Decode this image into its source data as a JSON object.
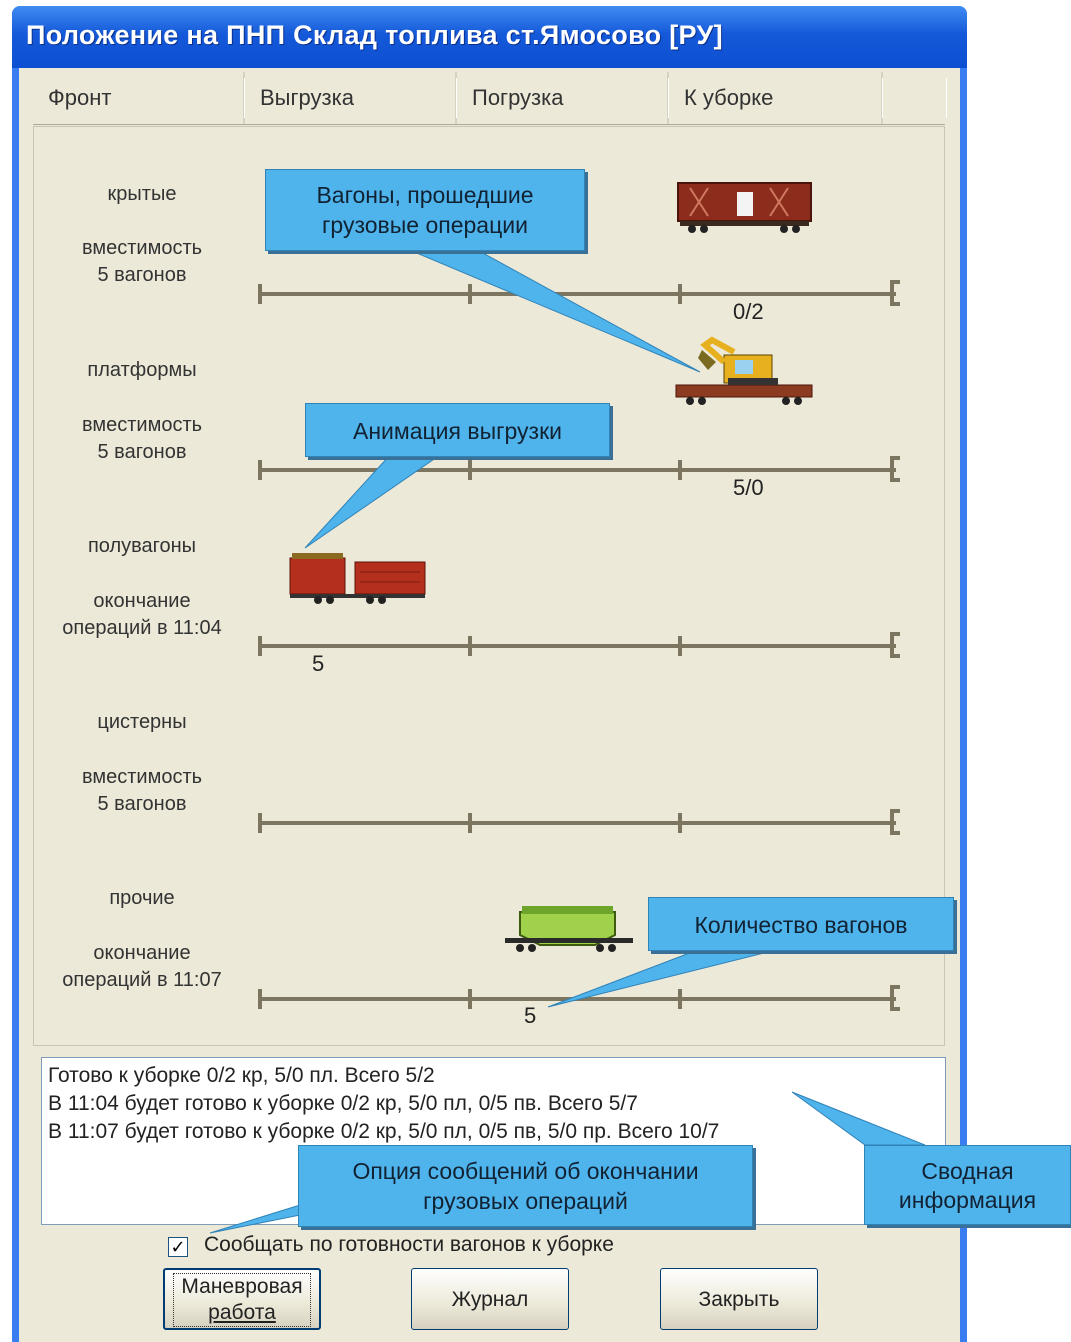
{
  "window": {
    "title": "Положение на ПНП Склад топлива  ст.Ямосово [РУ]"
  },
  "columns": [
    "Фронт",
    "Выгрузка",
    "Погрузка",
    "К уборке"
  ],
  "rows": [
    {
      "label": "крытые",
      "sub1": "вместимость",
      "sub2": "5 вагонов",
      "count": "0/2"
    },
    {
      "label": "платформы",
      "sub1": "вместимость",
      "sub2": "5 вагонов",
      "count": "5/0"
    },
    {
      "label": "полувагоны",
      "sub1": "окончание",
      "sub2": "операций в 11:04",
      "count": "5"
    },
    {
      "label": "цистерны",
      "sub1": "вместимость",
      "sub2": "5 вагонов",
      "count": ""
    },
    {
      "label": "прочие",
      "sub1": "окончание",
      "sub2": "операций в 11:07",
      "count": "5"
    }
  ],
  "callouts": {
    "processed_line1": "Вагоны, прошедшие",
    "processed_line2": "грузовые операции",
    "animation": "Анимация выгрузки",
    "count": "Количество вагонов",
    "summary_line1": "Сводная",
    "summary_line2": "информация",
    "option_line1": "Опция сообщений об окончании",
    "option_line2": "грузовых операций"
  },
  "info_lines": [
    "Готово к уборке  0/2 кр, 5/0 пл. Всего 5/2",
    "В 11:04 будет готово к уборке  0/2 кр, 5/0 пл, 0/5 пв. Всего 5/7",
    "В 11:07 будет готово к уборке  0/2 кр, 5/0 пл, 0/5 пв, 5/0 пр. Всего 10/7"
  ],
  "notify_checkbox": {
    "checked": true,
    "label": "Сообщать по готовности вагонов к уборке"
  },
  "buttons": {
    "shunting_line1": "Маневровая",
    "shunting_line2": "работа",
    "journal": "Журнал",
    "close": "Закрыть"
  },
  "colors": {
    "title_bar": "#0d4fd2",
    "callout": "#4fb3ec",
    "dialog_bg": "#ece9d8"
  }
}
